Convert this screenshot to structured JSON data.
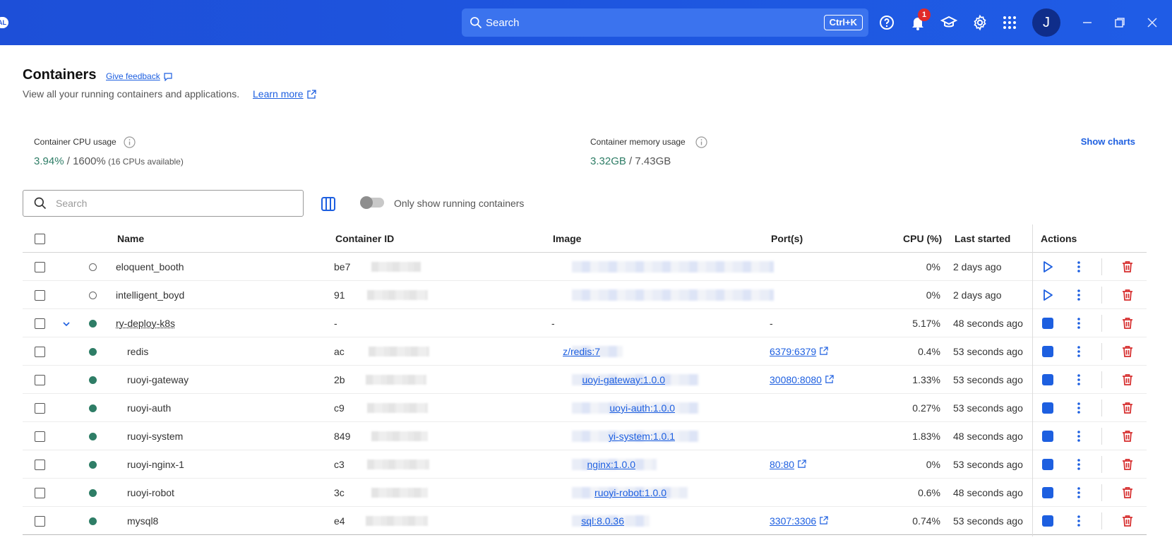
{
  "topbar": {
    "brand_text": "AL",
    "search_label": "Search",
    "search_shortcut": "Ctrl+K",
    "notification_count": "1",
    "avatar_initial": "J"
  },
  "header": {
    "title": "Containers",
    "feedback": "Give feedback",
    "subtitle": "View all your running containers and applications.",
    "learn_more": "Learn more"
  },
  "stats": {
    "cpu": {
      "label": "Container CPU usage",
      "used": "3.94%",
      "sep": " / ",
      "total": "1600%",
      "note": " (16 CPUs available)"
    },
    "memory": {
      "label": "Container memory usage",
      "used": "3.32GB",
      "sep": " / ",
      "total": "7.43GB"
    },
    "show_charts": "Show charts"
  },
  "filters": {
    "search_placeholder": "Search",
    "running_only_label": "Only show running containers",
    "running_only": false
  },
  "table": {
    "columns": [
      "Name",
      "Container ID",
      "Image",
      "Port(s)",
      "CPU (%)",
      "Last started",
      "Actions"
    ],
    "rows": [
      {
        "name": "eloquent_booth",
        "id": "be7",
        "image": "",
        "port": "",
        "cpu": "0%",
        "started": "2 days ago",
        "status": "stopped"
      },
      {
        "name": "intelligent_boyd",
        "id": "91",
        "image": "",
        "port": "",
        "cpu": "0%",
        "started": "2 days ago",
        "status": "stopped"
      },
      {
        "name": "ry-deploy-k8s",
        "id": "-",
        "image": "-",
        "port": "-",
        "cpu": "5.17%",
        "started": "48 seconds ago",
        "status": "running"
      },
      {
        "name": "redis",
        "id": "ac",
        "image": "z/redis:7",
        "port": "6379:6379",
        "cpu": "0.4%",
        "started": "53 seconds ago",
        "status": "running"
      },
      {
        "name": "ruoyi-gateway",
        "id": "2b",
        "image": "uoyi-gateway:1.0.0",
        "port": "30080:8080",
        "cpu": "1.33%",
        "started": "53 seconds ago",
        "status": "running"
      },
      {
        "name": "ruoyi-auth",
        "id": "c9",
        "image": "uoyi-auth:1.0.0",
        "port": "",
        "cpu": "0.27%",
        "started": "53 seconds ago",
        "status": "running"
      },
      {
        "name": "ruoyi-system",
        "id": "849",
        "image": "yi-system:1.0.1",
        "port": "",
        "cpu": "1.83%",
        "started": "48 seconds ago",
        "status": "running"
      },
      {
        "name": "ruoyi-nginx-1",
        "id": "c3",
        "image": "nginx:1.0.0",
        "port": "80:80",
        "cpu": "0%",
        "started": "53 seconds ago",
        "status": "running"
      },
      {
        "name": "ruoyi-robot",
        "id": "3c",
        "image": "ruoyi-robot:1.0.0",
        "port": "",
        "cpu": "0.6%",
        "started": "48 seconds ago",
        "status": "running"
      },
      {
        "name": "mysql8",
        "id": "e4",
        "image": "sql:8.0.36",
        "port": "3307:3306",
        "cpu": "0.74%",
        "started": "53 seconds ago",
        "status": "running"
      }
    ]
  },
  "colors": {
    "accent": "#1d5fe0",
    "topbar": "#1d4fd8",
    "running": "#2e7d66",
    "delete": "#d62c2c"
  }
}
